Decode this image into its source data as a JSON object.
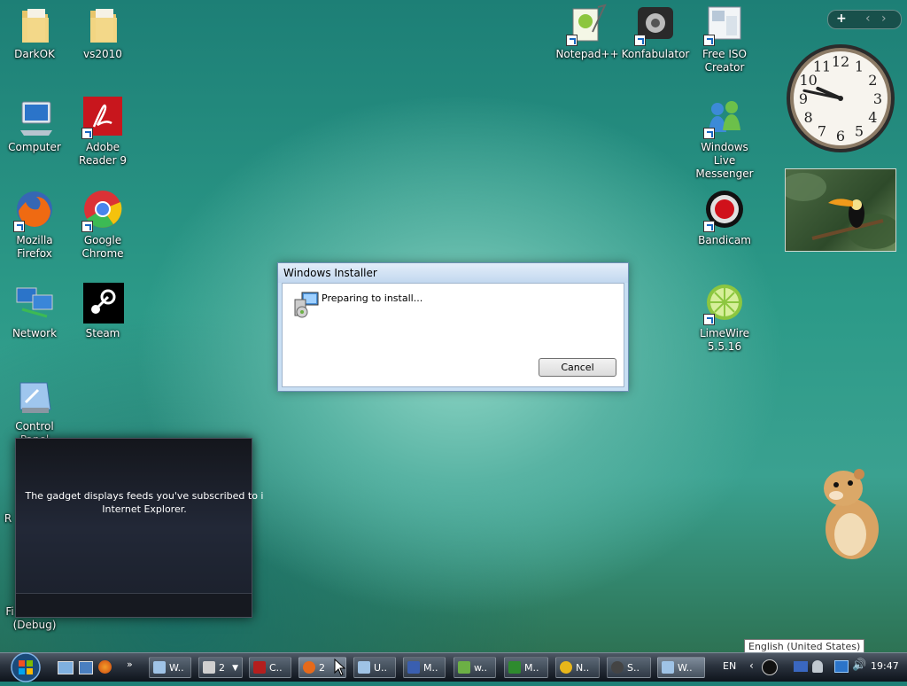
{
  "desktop_left": [
    {
      "label": "DarkOK",
      "icon": "folder-icon"
    },
    {
      "label": "vs2010",
      "icon": "folder-icon"
    },
    {
      "label": "Computer",
      "icon": "computer-icon"
    },
    {
      "label": "Adobe Reader 9",
      "icon": "adobe-reader-icon"
    },
    {
      "label": "Mozilla Firefox",
      "icon": "firefox-icon"
    },
    {
      "label": "Google Chrome",
      "icon": "chrome-icon"
    },
    {
      "label": "Network",
      "icon": "network-icon"
    },
    {
      "label": "Steam",
      "icon": "steam-icon"
    },
    {
      "label": "Control Panel",
      "icon": "control-panel-icon"
    }
  ],
  "desktop_right": [
    {
      "label": "Notepad++",
      "icon": "notepadpp-icon"
    },
    {
      "label": "Konfabulator",
      "icon": "konfabulator-icon"
    },
    {
      "label": "Free ISO Creator",
      "icon": "iso-creator-icon"
    },
    {
      "label": "Windows Live Messenger",
      "icon": "messenger-icon"
    },
    {
      "label": "Bandicam",
      "icon": "bandicam-icon"
    },
    {
      "label": "LimeWire 5.5.16",
      "icon": "limewire-icon"
    }
  ],
  "partial_labels": {
    "r_label": "R",
    "f_label": "Fi",
    "debug_label": "(Debug)"
  },
  "installer": {
    "title": "Windows Installer",
    "message": "Preparing to install...",
    "cancel_label": "Cancel"
  },
  "feed_gadget": {
    "message_line1": "The gadget displays feeds you've subscribed to i",
    "message_line2": "Internet Explorer."
  },
  "sidebar_controls": {
    "add_label": "+",
    "prev_label": "‹",
    "next_label": "›"
  },
  "clock": {
    "hour": 9,
    "minute": 47,
    "numbers": [
      "12",
      "1",
      "2",
      "3",
      "4",
      "5",
      "6",
      "7",
      "8",
      "9",
      "10",
      "11"
    ]
  },
  "taskbar": {
    "buttons": [
      {
        "label": "W..",
        "color": "#9fc3e6"
      },
      {
        "label": "2",
        "color": "#d0d0d0"
      },
      {
        "label": "C..",
        "color": "#b41e1e"
      },
      {
        "label": "2",
        "color": "#e66a1b"
      },
      {
        "label": "U..",
        "color": "#9fc3e6"
      },
      {
        "label": "M..",
        "color": "#3a5fb0"
      },
      {
        "label": "w..",
        "color": "#6cb045"
      },
      {
        "label": "M..",
        "color": "#2e8b2e"
      },
      {
        "label": "N..",
        "color": "#e8b61a"
      },
      {
        "label": "S..",
        "color": "#444444"
      },
      {
        "label": "W..",
        "color": "#9fc3e6"
      }
    ],
    "language": "EN",
    "language_tooltip": "English (United States)",
    "clock": "19:47"
  }
}
